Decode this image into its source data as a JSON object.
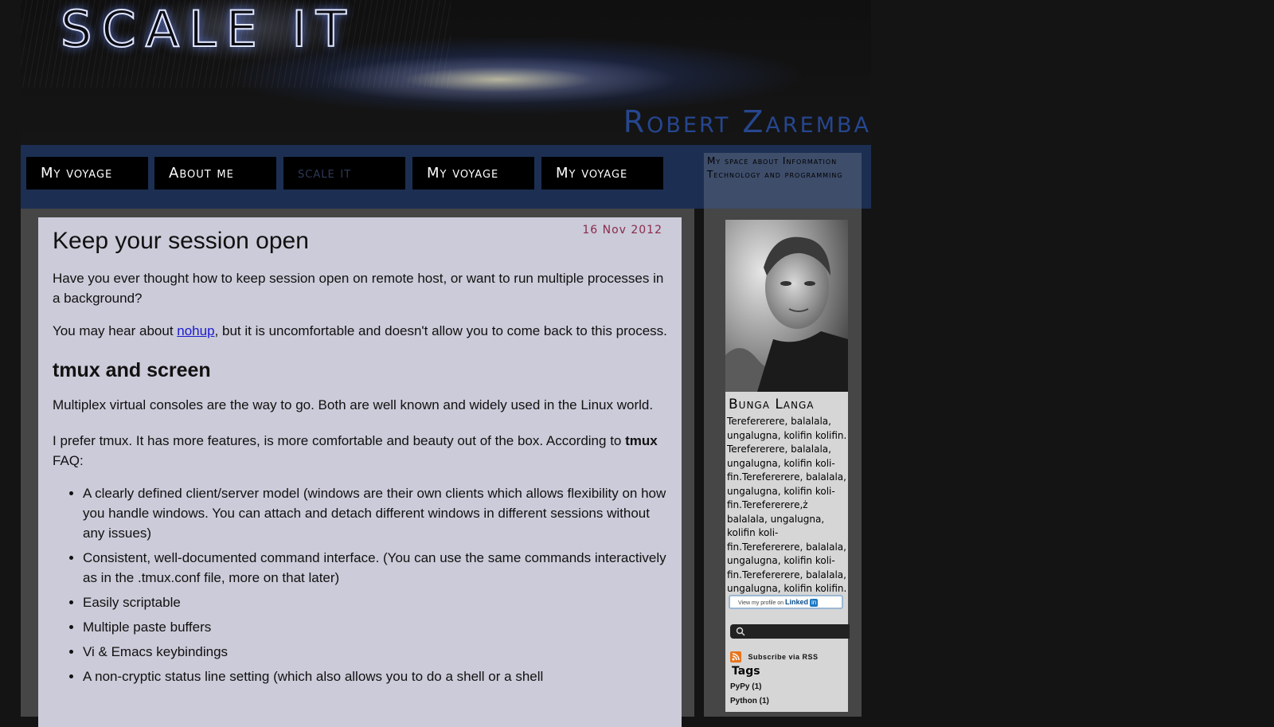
{
  "header": {
    "site_title": "SCALE IT",
    "author": "Robert Zaremba"
  },
  "nav": {
    "items": [
      {
        "label": "My voyage"
      },
      {
        "label": "About me"
      },
      {
        "label": "scale it"
      },
      {
        "label": "My voyage"
      },
      {
        "label": "My voyage"
      }
    ],
    "tagline": "My space about Information Technology and programming"
  },
  "post": {
    "title": "Keep your session open",
    "date": "16 Nov 2012",
    "intro": "Have you ever thought how to keep session open on remote host, or want to run multiple processes in a background?",
    "p2_before": "You may hear about ",
    "p2_link": "nohup",
    "p2_after": ", but it is uncomfortable and doesn't allow you to come back to this process.",
    "h2": "tmux and screen",
    "p3": "Multiplex virtual consoles are the way to go. Both are well known and widely used in the Linux world.",
    "p4_before": "I prefer tmux. It has more features, is more comfortable and beauty out of the box. According to ",
    "p4_bold": "tmux",
    "p4_after": " FAQ:",
    "list": [
      "A clearly defined client/server model (windows are their own clients which allows flexibility on how you handle windows. You can attach and detach different windows in different sessions without any issues)",
      "Consistent, well-documented command interface. (You can use the same commands interactively as in the .tmux.conf file, more on that later)",
      "Easily scriptable",
      "Multiple paste buffers",
      "Vi & Emacs keybindings",
      "A non-cryptic status line setting (which also allows you to do a shell or a shell"
    ]
  },
  "sidebar": {
    "profile_name": "Bunga Langa",
    "bio": "Terefererere, balalala, ungalugna, kolifin kolifin. Terefererere, balalala, ungalugna, kolifin koli-fin.Terefererere, balalala, ungalugna, kolifin koli-fin.Terefererere,ż balalala, ungalugna, kolifin koli-fin.Terefererere, balalala, ungalugna, kolifin koli-fin.Terefererere, balalala, ungalugna, kolifin kolifin.",
    "linkedin_text": "View my profile on",
    "linkedin_brand": "Linked",
    "linkedin_in": "in",
    "search_placeholder": "",
    "rss_label": "Subscribe via RSS",
    "tags_heading": "Tags",
    "tags": [
      {
        "label": "PyPy (1)"
      },
      {
        "label": "Python (1)"
      }
    ]
  },
  "colors": {
    "background": "#141414",
    "nav_bar": "#1c2f52",
    "post_background": "#cbcbd9",
    "date_color": "#8a2a4a",
    "link_color": "#1a1ad0",
    "author_color": "#26468f"
  },
  "icons": {
    "search": "search-icon",
    "rss": "rss-icon",
    "linkedin": "linkedin-icon"
  }
}
